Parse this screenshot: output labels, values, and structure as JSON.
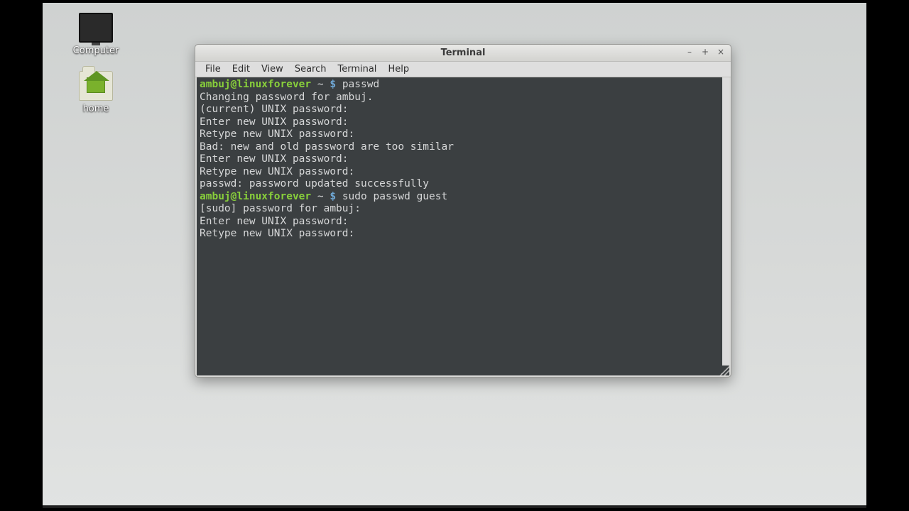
{
  "desktop": {
    "icons": {
      "computer_label": "Computer",
      "home_label": "home"
    }
  },
  "window": {
    "title": "Terminal",
    "controls": {
      "minimize": "–",
      "maximize": "+",
      "close": "×"
    },
    "menu": {
      "file": "File",
      "edit": "Edit",
      "view": "View",
      "search": "Search",
      "terminal": "Terminal",
      "help": "Help"
    }
  },
  "terminal": {
    "prompt": {
      "user_host": "ambuj@linuxforever",
      "path": " ~ ",
      "symbol": "$ "
    },
    "lines": [
      {
        "type": "prompt",
        "cmd": "passwd"
      },
      {
        "type": "out",
        "text": "Changing password for ambuj."
      },
      {
        "type": "out",
        "text": "(current) UNIX password: "
      },
      {
        "type": "out",
        "text": "Enter new UNIX password: "
      },
      {
        "type": "out",
        "text": "Retype new UNIX password: "
      },
      {
        "type": "out",
        "text": "Bad: new and old password are too similar"
      },
      {
        "type": "out",
        "text": "Enter new UNIX password: "
      },
      {
        "type": "out",
        "text": "Retype new UNIX password: "
      },
      {
        "type": "out",
        "text": "passwd: password updated successfully"
      },
      {
        "type": "prompt",
        "cmd": "sudo passwd guest"
      },
      {
        "type": "out",
        "text": "[sudo] password for ambuj: "
      },
      {
        "type": "out",
        "text": "Enter new UNIX password: "
      },
      {
        "type": "out",
        "text": "Retype new UNIX password: "
      }
    ]
  }
}
